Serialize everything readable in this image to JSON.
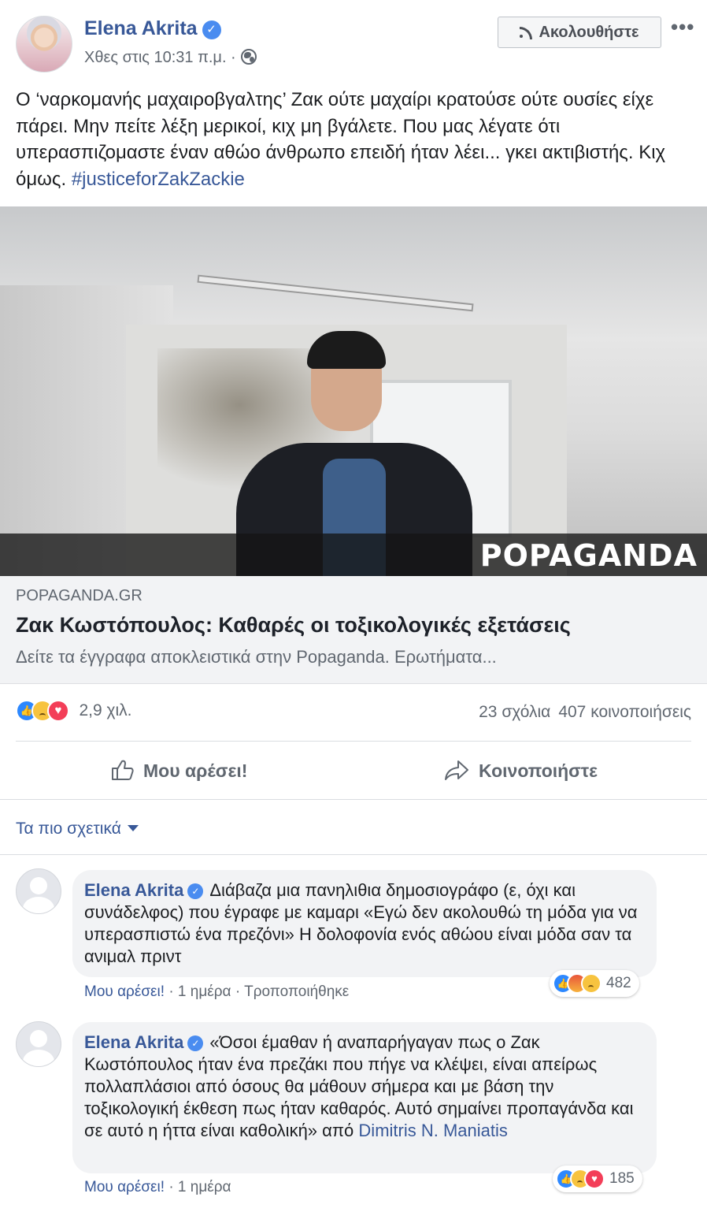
{
  "post": {
    "author": "Elena Akrita",
    "time": "Χθες στις 10:31 π.μ. ·",
    "follow_label": "Ακολουθήστε",
    "more_label": "•••",
    "text": "Ο ‘ναρκομανής μαχαιροβγαλτης’ Ζακ ούτε μαχαίρι κρατούσε ούτε ουσίες είχε πάρει. Μην πείτε λέξη μερικοί, κιχ μη βγάλετε. Που μας λέγατε ότι υπερασπιζομαστε έναν αθώο άνθρωπο επειδή ήταν λέει... γκει ακτιβιστής. Κιχ όμως.",
    "hashtag": "#justiceforZakZackie"
  },
  "link": {
    "image_brand": "POPAGANDA",
    "domain": "POPAGANDA.GR",
    "title": "Ζακ Κωστόπουλος: Καθαρές οι τοξικολογικές εξετάσεις",
    "description": "Δείτε τα έγγραφα αποκλειστικά στην Popaganda. Ερωτήματα..."
  },
  "summary": {
    "reactions_count": "2,9 χιλ.",
    "reactions": [
      "like-icon",
      "sad-icon",
      "love-icon"
    ],
    "comments": "23 σχόλια",
    "shares": "407 κοινοποιήσεις"
  },
  "actions": {
    "like_label": "Μου αρέσει!",
    "share_label": "Κοινοποιήστε"
  },
  "comments_section": {
    "sort_label": "Τα πιο σχετικά",
    "items": [
      {
        "author": "Elena Akrita",
        "text": "Διάβαζα μια πανηλιθια δημοσιογράφο (ε, όχι και συνάδελφος) που έγραφε με καμαρι «Εγώ δεν ακολουθώ τη μόδα για να υπερασπιστώ ένα πρεζόνι» Η δολοφονία ενός αθώου είναι μόδα σαν τα ανιμαλ πριντ",
        "like_label": "Μου αρέσει!",
        "time": "1 ημέρα",
        "edited": "Τροποποιήθηκε",
        "reactions": [
          "like-icon",
          "angry-icon",
          "sad-icon"
        ],
        "reaction_count": "482"
      },
      {
        "author": "Elena Akrita",
        "text": "«Όσοι έμαθαν ή αναπαρήγαγαν πως ο Ζακ Κωστόπουλος ήταν ένα πρεζάκι που πήγε να κλέψει, είναι απείρως πολλαπλάσιοι από όσους θα μάθουν σήμερα και με βάση την τοξικολογική έκθεση πως ήταν καθαρός. Αυτό σημαίνει προπαγάνδα και σε αυτό η ήττα είναι καθολική» από",
        "tagged": "Dimitris N. Maniatis",
        "like_label": "Μου αρέσει!",
        "time": "1 ημέρα",
        "reactions": [
          "like-icon",
          "sad-icon",
          "love-icon"
        ],
        "reaction_count": "185"
      }
    ]
  },
  "colors": {
    "link_blue": "#385898",
    "secondary_text": "#606770",
    "like_blue": "#2d88ff",
    "love_red": "#f33e58",
    "sad_yellow": "#f7c33f"
  }
}
